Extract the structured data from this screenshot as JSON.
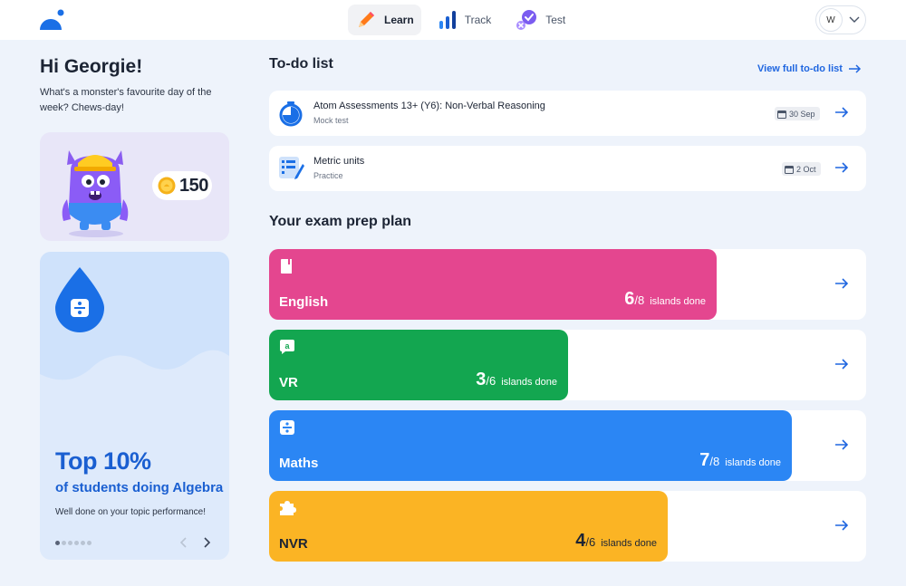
{
  "nav": {
    "items": [
      {
        "label": "Learn",
        "icon": "pencil-icon",
        "active": true
      },
      {
        "label": "Track",
        "icon": "bar-chart-icon",
        "active": false
      },
      {
        "label": "Test",
        "icon": "check-badge-icon",
        "active": false
      }
    ]
  },
  "user": {
    "initial": "W"
  },
  "greeting": "Hi Georgie!",
  "joke": "What's a monster's favourite day of the week? Chews-day!",
  "coins": "150",
  "promo": {
    "title": "Top 10%",
    "subtitle": "of students doing Algebra",
    "note": "Well done on your topic performance!",
    "slides": 6,
    "active_slide": 1
  },
  "todo": {
    "title": "To-do list",
    "view_all": "View full to-do list",
    "items": [
      {
        "name": "Atom Assessments 13+ (Y6): Non-Verbal Reasoning",
        "type": "Mock test",
        "date": "30 Sep",
        "icon": "stopwatch-icon"
      },
      {
        "name": "Metric units",
        "type": "Practice",
        "date": "2 Oct",
        "icon": "practice-list-icon"
      }
    ]
  },
  "plan": {
    "title": "Your exam prep plan",
    "items": [
      {
        "subject": "English",
        "done": "6",
        "total": "/8",
        "label": "islands done",
        "progress": 0.75,
        "color": "#e4468f",
        "icon": "book-icon"
      },
      {
        "subject": "VR",
        "done": "3",
        "total": "/6",
        "label": "islands done",
        "progress": 0.5,
        "color": "#13a650",
        "icon": "letter-a-icon"
      },
      {
        "subject": "Maths",
        "done": "7",
        "total": "/8",
        "label": "islands done",
        "progress": 0.875,
        "color": "#2b86f4",
        "icon": "divide-icon"
      },
      {
        "subject": "NVR",
        "done": "4",
        "total": "/6",
        "label": "islands done",
        "progress": 0.667,
        "color": "#fbb424",
        "icon": "puzzle-icon"
      }
    ]
  },
  "colors": {
    "accent": "#1f66e0",
    "brand": "#1a6fe6"
  }
}
